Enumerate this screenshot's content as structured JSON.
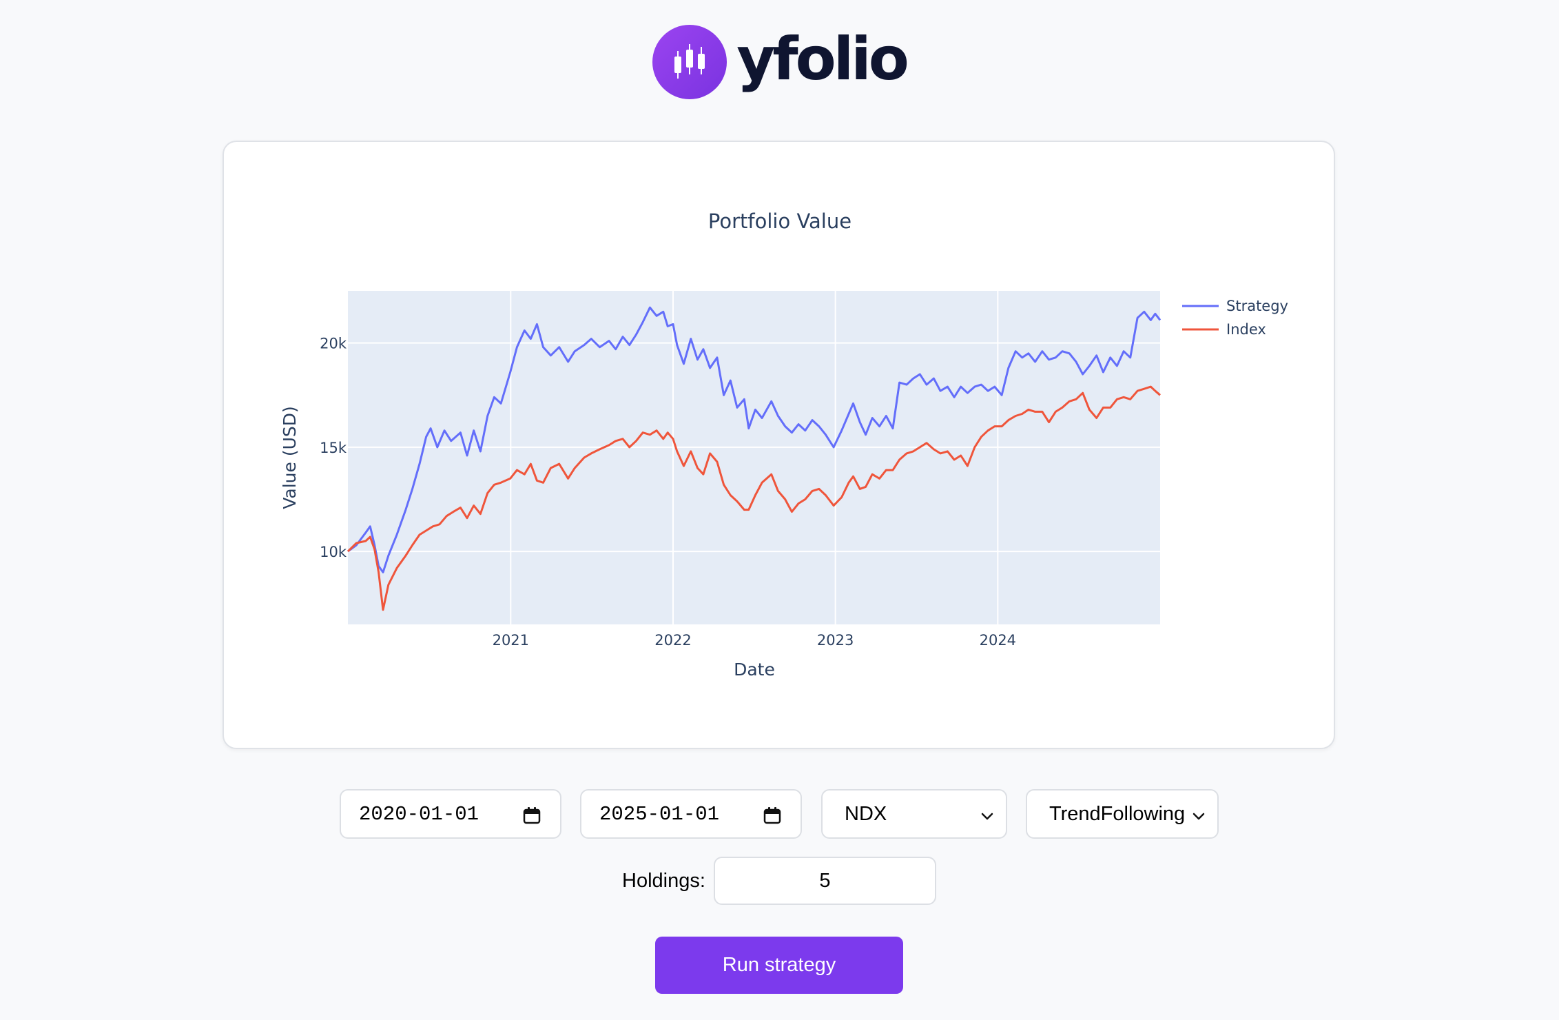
{
  "brand": {
    "name": "yfolio",
    "icon": "candlestick-icon",
    "accent": "#7c3aed"
  },
  "chart_data": {
    "type": "line",
    "title": "Portfolio Value",
    "xlabel": "Date",
    "ylabel": "Value (USD)",
    "x_ticks": [
      "2021",
      "2022",
      "2023",
      "2024"
    ],
    "y_ticks": [
      "10k",
      "15k",
      "20k"
    ],
    "xlim": [
      "2020-01-01",
      "2024-12-31"
    ],
    "ylim": [
      6500,
      22500
    ],
    "grid": true,
    "legend_position": "top-right",
    "series": [
      {
        "name": "Strategy",
        "color": "#636efa",
        "points": [
          [
            "2020-01-01",
            10000
          ],
          [
            "2020-01-20",
            10300
          ],
          [
            "2020-02-10",
            10900
          ],
          [
            "2020-02-20",
            11200
          ],
          [
            "2020-03-01",
            10300
          ],
          [
            "2020-03-10",
            9300
          ],
          [
            "2020-03-20",
            9000
          ],
          [
            "2020-04-01",
            9800
          ],
          [
            "2020-04-20",
            10800
          ],
          [
            "2020-05-10",
            12000
          ],
          [
            "2020-05-25",
            13000
          ],
          [
            "2020-06-10",
            14200
          ],
          [
            "2020-06-25",
            15500
          ],
          [
            "2020-07-05",
            15900
          ],
          [
            "2020-07-20",
            15000
          ],
          [
            "2020-08-05",
            15800
          ],
          [
            "2020-08-20",
            15300
          ],
          [
            "2020-09-10",
            15700
          ],
          [
            "2020-09-25",
            14600
          ],
          [
            "2020-10-10",
            15800
          ],
          [
            "2020-10-25",
            14800
          ],
          [
            "2020-11-10",
            16500
          ],
          [
            "2020-11-25",
            17400
          ],
          [
            "2020-12-10",
            17100
          ],
          [
            "2020-12-31",
            18600
          ],
          [
            "2021-01-15",
            19800
          ],
          [
            "2021-02-01",
            20600
          ],
          [
            "2021-02-15",
            20200
          ],
          [
            "2021-03-01",
            20900
          ],
          [
            "2021-03-15",
            19800
          ],
          [
            "2021-04-01",
            19400
          ],
          [
            "2021-04-20",
            19800
          ],
          [
            "2021-05-10",
            19100
          ],
          [
            "2021-05-25",
            19600
          ],
          [
            "2021-06-15",
            19900
          ],
          [
            "2021-07-01",
            20200
          ],
          [
            "2021-07-20",
            19800
          ],
          [
            "2021-08-10",
            20100
          ],
          [
            "2021-08-25",
            19700
          ],
          [
            "2021-09-10",
            20300
          ],
          [
            "2021-09-25",
            19900
          ],
          [
            "2021-10-10",
            20400
          ],
          [
            "2021-10-25",
            21000
          ],
          [
            "2021-11-10",
            21700
          ],
          [
            "2021-11-25",
            21300
          ],
          [
            "2021-12-10",
            21500
          ],
          [
            "2021-12-20",
            20800
          ],
          [
            "2022-01-01",
            20900
          ],
          [
            "2022-01-10",
            19900
          ],
          [
            "2022-01-25",
            19000
          ],
          [
            "2022-02-10",
            20200
          ],
          [
            "2022-02-25",
            19200
          ],
          [
            "2022-03-10",
            19700
          ],
          [
            "2022-03-25",
            18800
          ],
          [
            "2022-04-10",
            19300
          ],
          [
            "2022-04-25",
            17500
          ],
          [
            "2022-05-10",
            18200
          ],
          [
            "2022-05-25",
            16900
          ],
          [
            "2022-06-10",
            17300
          ],
          [
            "2022-06-20",
            15900
          ],
          [
            "2022-07-05",
            16800
          ],
          [
            "2022-07-20",
            16400
          ],
          [
            "2022-08-10",
            17200
          ],
          [
            "2022-08-25",
            16500
          ],
          [
            "2022-09-10",
            16000
          ],
          [
            "2022-09-25",
            15700
          ],
          [
            "2022-10-10",
            16100
          ],
          [
            "2022-10-25",
            15800
          ],
          [
            "2022-11-10",
            16300
          ],
          [
            "2022-11-25",
            16000
          ],
          [
            "2022-12-10",
            15600
          ],
          [
            "2022-12-28",
            15000
          ],
          [
            "2023-01-15",
            15800
          ],
          [
            "2023-01-31",
            16600
          ],
          [
            "2023-02-10",
            17100
          ],
          [
            "2023-02-25",
            16200
          ],
          [
            "2023-03-10",
            15600
          ],
          [
            "2023-03-25",
            16400
          ],
          [
            "2023-04-10",
            16000
          ],
          [
            "2023-04-25",
            16500
          ],
          [
            "2023-05-10",
            15900
          ],
          [
            "2023-05-25",
            18100
          ],
          [
            "2023-06-10",
            18000
          ],
          [
            "2023-06-25",
            18300
          ],
          [
            "2023-07-10",
            18500
          ],
          [
            "2023-07-25",
            18000
          ],
          [
            "2023-08-10",
            18300
          ],
          [
            "2023-08-25",
            17700
          ],
          [
            "2023-09-10",
            17900
          ],
          [
            "2023-09-25",
            17400
          ],
          [
            "2023-10-10",
            17900
          ],
          [
            "2023-10-25",
            17600
          ],
          [
            "2023-11-10",
            17900
          ],
          [
            "2023-11-25",
            18000
          ],
          [
            "2023-12-10",
            17700
          ],
          [
            "2023-12-25",
            17900
          ],
          [
            "2024-01-10",
            17500
          ],
          [
            "2024-01-25",
            18800
          ],
          [
            "2024-02-10",
            19600
          ],
          [
            "2024-02-25",
            19300
          ],
          [
            "2024-03-10",
            19500
          ],
          [
            "2024-03-25",
            19100
          ],
          [
            "2024-04-10",
            19600
          ],
          [
            "2024-04-25",
            19200
          ],
          [
            "2024-05-10",
            19300
          ],
          [
            "2024-05-25",
            19600
          ],
          [
            "2024-06-10",
            19500
          ],
          [
            "2024-06-25",
            19100
          ],
          [
            "2024-07-10",
            18500
          ],
          [
            "2024-07-25",
            18900
          ],
          [
            "2024-08-10",
            19400
          ],
          [
            "2024-08-25",
            18600
          ],
          [
            "2024-09-10",
            19300
          ],
          [
            "2024-09-25",
            18900
          ],
          [
            "2024-10-10",
            19600
          ],
          [
            "2024-10-25",
            19300
          ],
          [
            "2024-11-10",
            21200
          ],
          [
            "2024-11-25",
            21500
          ],
          [
            "2024-12-10",
            21100
          ],
          [
            "2024-12-20",
            21400
          ],
          [
            "2024-12-31",
            21100
          ]
        ]
      },
      {
        "name": "Index",
        "color": "#ef553b",
        "points": [
          [
            "2020-01-01",
            10000
          ],
          [
            "2020-01-20",
            10400
          ],
          [
            "2020-02-10",
            10500
          ],
          [
            "2020-02-20",
            10700
          ],
          [
            "2020-03-01",
            10100
          ],
          [
            "2020-03-10",
            9000
          ],
          [
            "2020-03-20",
            7200
          ],
          [
            "2020-04-01",
            8400
          ],
          [
            "2020-04-20",
            9200
          ],
          [
            "2020-05-10",
            9800
          ],
          [
            "2020-05-25",
            10300
          ],
          [
            "2020-06-10",
            10800
          ],
          [
            "2020-06-25",
            11000
          ],
          [
            "2020-07-10",
            11200
          ],
          [
            "2020-07-25",
            11300
          ],
          [
            "2020-08-10",
            11700
          ],
          [
            "2020-08-25",
            11900
          ],
          [
            "2020-09-10",
            12100
          ],
          [
            "2020-09-25",
            11600
          ],
          [
            "2020-10-10",
            12200
          ],
          [
            "2020-10-25",
            11800
          ],
          [
            "2020-11-10",
            12800
          ],
          [
            "2020-11-25",
            13200
          ],
          [
            "2020-12-10",
            13300
          ],
          [
            "2020-12-31",
            13500
          ],
          [
            "2021-01-15",
            13900
          ],
          [
            "2021-02-01",
            13700
          ],
          [
            "2021-02-15",
            14200
          ],
          [
            "2021-03-01",
            13400
          ],
          [
            "2021-03-15",
            13300
          ],
          [
            "2021-04-01",
            14000
          ],
          [
            "2021-04-20",
            14200
          ],
          [
            "2021-05-10",
            13500
          ],
          [
            "2021-05-25",
            14000
          ],
          [
            "2021-06-15",
            14500
          ],
          [
            "2021-07-01",
            14700
          ],
          [
            "2021-07-20",
            14900
          ],
          [
            "2021-08-10",
            15100
          ],
          [
            "2021-08-25",
            15300
          ],
          [
            "2021-09-10",
            15400
          ],
          [
            "2021-09-25",
            15000
          ],
          [
            "2021-10-10",
            15300
          ],
          [
            "2021-10-25",
            15700
          ],
          [
            "2021-11-10",
            15600
          ],
          [
            "2021-11-25",
            15800
          ],
          [
            "2021-12-10",
            15400
          ],
          [
            "2021-12-20",
            15700
          ],
          [
            "2022-01-01",
            15400
          ],
          [
            "2022-01-10",
            14800
          ],
          [
            "2022-01-25",
            14100
          ],
          [
            "2022-02-10",
            14800
          ],
          [
            "2022-02-25",
            14000
          ],
          [
            "2022-03-10",
            13700
          ],
          [
            "2022-03-25",
            14700
          ],
          [
            "2022-04-10",
            14300
          ],
          [
            "2022-04-25",
            13200
          ],
          [
            "2022-05-10",
            12700
          ],
          [
            "2022-05-25",
            12400
          ],
          [
            "2022-06-10",
            12000
          ],
          [
            "2022-06-20",
            12000
          ],
          [
            "2022-07-05",
            12700
          ],
          [
            "2022-07-20",
            13300
          ],
          [
            "2022-08-10",
            13700
          ],
          [
            "2022-08-25",
            12900
          ],
          [
            "2022-09-10",
            12500
          ],
          [
            "2022-09-25",
            11900
          ],
          [
            "2022-10-10",
            12300
          ],
          [
            "2022-10-25",
            12500
          ],
          [
            "2022-11-10",
            12900
          ],
          [
            "2022-11-25",
            13000
          ],
          [
            "2022-12-10",
            12700
          ],
          [
            "2022-12-28",
            12200
          ],
          [
            "2023-01-15",
            12600
          ],
          [
            "2023-01-31",
            13300
          ],
          [
            "2023-02-10",
            13600
          ],
          [
            "2023-02-25",
            13000
          ],
          [
            "2023-03-10",
            13100
          ],
          [
            "2023-03-25",
            13700
          ],
          [
            "2023-04-10",
            13500
          ],
          [
            "2023-04-25",
            13900
          ],
          [
            "2023-05-10",
            13900
          ],
          [
            "2023-05-25",
            14400
          ],
          [
            "2023-06-10",
            14700
          ],
          [
            "2023-06-25",
            14800
          ],
          [
            "2023-07-10",
            15000
          ],
          [
            "2023-07-25",
            15200
          ],
          [
            "2023-08-10",
            14900
          ],
          [
            "2023-08-25",
            14700
          ],
          [
            "2023-09-10",
            14800
          ],
          [
            "2023-09-25",
            14400
          ],
          [
            "2023-10-10",
            14600
          ],
          [
            "2023-10-25",
            14100
          ],
          [
            "2023-11-10",
            15000
          ],
          [
            "2023-11-25",
            15500
          ],
          [
            "2023-12-10",
            15800
          ],
          [
            "2023-12-25",
            16000
          ],
          [
            "2024-01-10",
            16000
          ],
          [
            "2024-01-25",
            16300
          ],
          [
            "2024-02-10",
            16500
          ],
          [
            "2024-02-25",
            16600
          ],
          [
            "2024-03-10",
            16800
          ],
          [
            "2024-03-25",
            16700
          ],
          [
            "2024-04-10",
            16700
          ],
          [
            "2024-04-25",
            16200
          ],
          [
            "2024-05-10",
            16700
          ],
          [
            "2024-05-25",
            16900
          ],
          [
            "2024-06-10",
            17200
          ],
          [
            "2024-06-25",
            17300
          ],
          [
            "2024-07-10",
            17600
          ],
          [
            "2024-07-25",
            16800
          ],
          [
            "2024-08-10",
            16400
          ],
          [
            "2024-08-25",
            16900
          ],
          [
            "2024-09-10",
            16900
          ],
          [
            "2024-09-25",
            17300
          ],
          [
            "2024-10-10",
            17400
          ],
          [
            "2024-10-25",
            17300
          ],
          [
            "2024-11-10",
            17700
          ],
          [
            "2024-11-25",
            17800
          ],
          [
            "2024-12-10",
            17900
          ],
          [
            "2024-12-20",
            17700
          ],
          [
            "2024-12-31",
            17500
          ]
        ]
      }
    ]
  },
  "controls": {
    "start_date": "2020-01-01",
    "end_date": "2025-01-01",
    "index_select": "NDX",
    "strategy_select": "TrendFollowing",
    "holdings_label": "Holdings:",
    "holdings_value": "5",
    "run_button": "Run strategy",
    "calendar_icon": "calendar-icon",
    "dropdown_icon": "chevron-down-icon"
  }
}
